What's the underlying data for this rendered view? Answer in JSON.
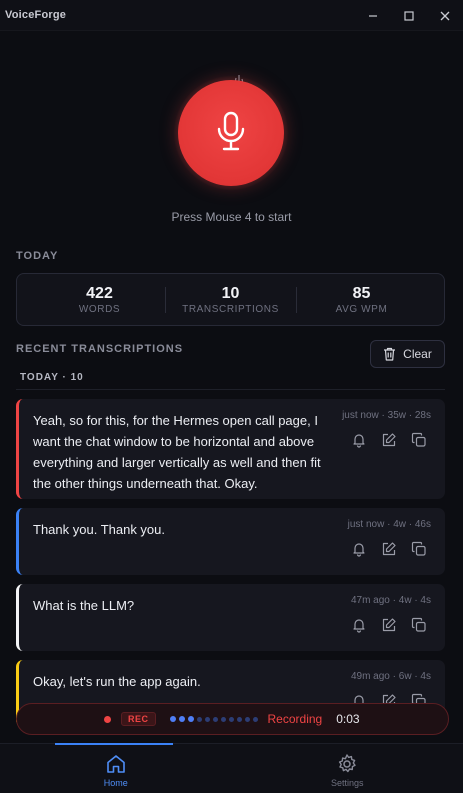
{
  "app": {
    "title": "VoiceForge"
  },
  "window_controls": {
    "minimize": "–",
    "maximize": "☐",
    "close": "✕"
  },
  "recorder": {
    "hint": "Press Mouse 4 to start",
    "accent": "#ef4444"
  },
  "today": {
    "label": "TODAY",
    "stats": [
      {
        "value": "422",
        "label": "WORDS"
      },
      {
        "value": "10",
        "label": "TRANSCRIPTIONS"
      },
      {
        "value": "85",
        "label": "AVG WPM"
      }
    ]
  },
  "recent": {
    "label": "RECENT TRANSCRIPTIONS",
    "clear_label": "Clear",
    "group_label": "TODAY · 10",
    "items": [
      {
        "text": "Yeah, so for this, for the Hermes open call page, I want the chat window to be horizontal and above everything and larger vertically as well and then fit the other things underneath that. Okay.",
        "meta": "just now · 35w · 28s",
        "accent": "#ef4444"
      },
      {
        "text": "Thank you. Thank you.",
        "meta": "just now · 4w · 46s",
        "accent": "#3b82f6"
      },
      {
        "text": "What is the LLM?",
        "meta": "47m ago · 4w · 4s",
        "accent": "#f4f4f6"
      },
      {
        "text": "Okay, let's run the app again.",
        "meta": "49m ago · 6w · 4s",
        "accent": "#facc15"
      }
    ]
  },
  "recording_bar": {
    "badge": "REC",
    "status": "Recording",
    "time": "0:03",
    "level": 0.3
  },
  "nav": {
    "home": "Home",
    "settings": "Settings"
  },
  "icons": {
    "mic": "microphone-icon",
    "trash": "trash-icon",
    "bell": "bell-icon",
    "edit": "edit-icon",
    "copy": "copy-icon",
    "home": "home-icon",
    "settings": "gear-icon"
  }
}
